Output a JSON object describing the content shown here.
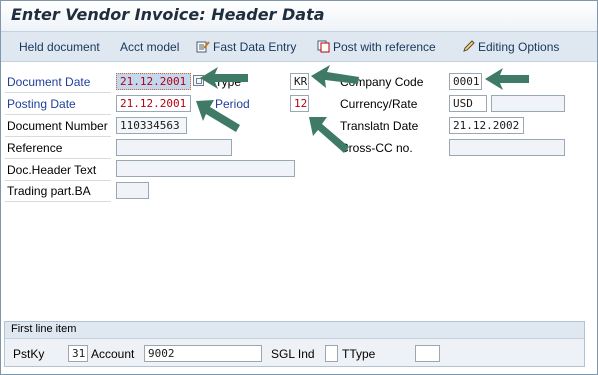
{
  "title": "Enter Vendor Invoice: Header Data",
  "toolbar": {
    "held_document": "Held document",
    "acct_model": "Acct model",
    "fast_data_entry": "Fast Data Entry",
    "post_with_reference": "Post with reference",
    "editing_options": "Editing Options"
  },
  "header": {
    "document_date": {
      "label": "Document Date",
      "value": "21.12.2001"
    },
    "type": {
      "label": "Type",
      "value": "KR"
    },
    "company_code": {
      "label": "Company Code",
      "value": "0001"
    },
    "posting_date": {
      "label": "Posting Date",
      "value": "21.12.2001"
    },
    "period": {
      "label": "Period",
      "value": "12"
    },
    "currency_rate": {
      "label": "Currency/Rate",
      "value": "USD",
      "rate": ""
    },
    "document_number": {
      "label": "Document Number",
      "value": "110334563"
    },
    "translatn_date": {
      "label": "Translatn Date",
      "value": "21.12.2002"
    },
    "reference": {
      "label": "Reference",
      "value": ""
    },
    "cross_cc": {
      "label": "Cross-CC no.",
      "value": ""
    },
    "doc_header_text": {
      "label": "Doc.Header Text",
      "value": ""
    },
    "trading_part": {
      "label": "Trading part.BA",
      "value": ""
    }
  },
  "first_line_item": {
    "title": "First line item",
    "pstky": {
      "label": "PstKy",
      "value": "31"
    },
    "account": {
      "label": "Account",
      "value": "9002"
    },
    "sgl_ind": {
      "label": "SGL Ind",
      "value": ""
    },
    "ttype": {
      "label": "TType",
      "value": ""
    }
  },
  "colors": {
    "required_label": "#1f3f9a",
    "red_value": "#b5000f",
    "annotation_arrow": "#3f7a66",
    "toolbar_bg": "#dfe8f1"
  }
}
